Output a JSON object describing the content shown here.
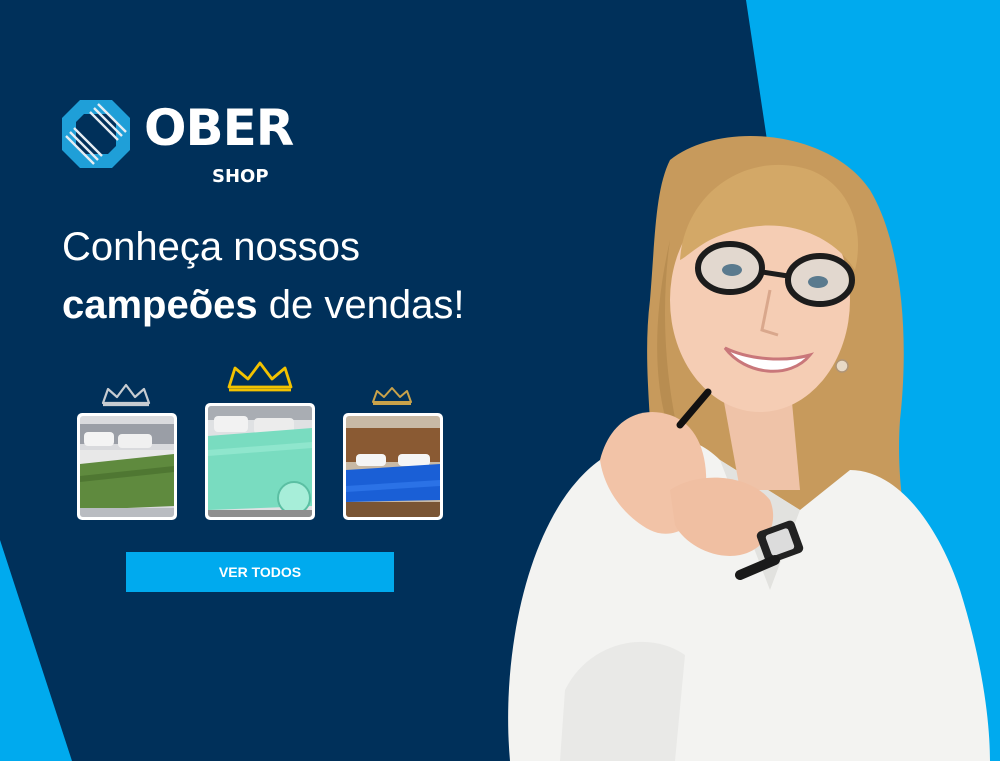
{
  "brand": {
    "name": "OBER",
    "sub": "SHOP"
  },
  "headline": {
    "line1": "Conheça nossos",
    "bold": "campeões",
    "rest": " de vendas!"
  },
  "products": [
    {
      "rank": "silver",
      "crown_color": "#c7ccd1",
      "blanket_color": "#5f8a3e"
    },
    {
      "rank": "gold",
      "crown_color": "#f2c200",
      "blanket_color": "#79dcc0"
    },
    {
      "rank": "bronze",
      "crown_color": "#c9a24a",
      "blanket_color": "#1a5fd6"
    }
  ],
  "cta": {
    "label": "VER TODOS"
  },
  "colors": {
    "background": "#00305a",
    "accent": "#00aaee"
  }
}
